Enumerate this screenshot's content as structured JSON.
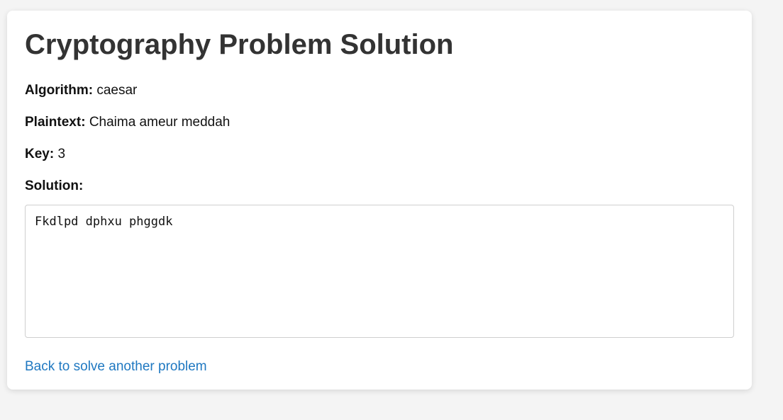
{
  "page": {
    "title": "Cryptography Problem Solution"
  },
  "fields": {
    "algorithm": {
      "label": "Algorithm:",
      "value": "caesar"
    },
    "plaintext": {
      "label": "Plaintext:",
      "value": "Chaima ameur meddah"
    },
    "key": {
      "label": "Key:",
      "value": "3"
    },
    "solution": {
      "label": "Solution:",
      "value": "Fkdlpd dphxu phggdk"
    }
  },
  "links": {
    "back": "Back to solve another problem"
  },
  "colors": {
    "background": "#f4f4f4",
    "card": "#ffffff",
    "title": "#333333",
    "link": "#1f78c1"
  }
}
